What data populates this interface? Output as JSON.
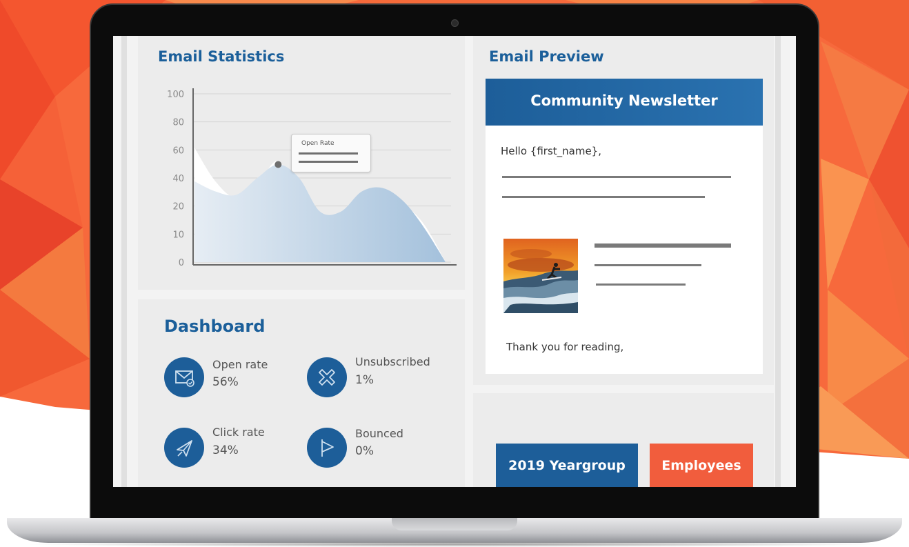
{
  "colors": {
    "brand_blue": "#1d5e99",
    "accent_orange": "#f15d3d",
    "panel_bg": "#ececec",
    "chart_fill": "#a9c4dc"
  },
  "stats": {
    "title": "Email Statistics",
    "tooltip_title": "Open Rate"
  },
  "chart_data": {
    "type": "area",
    "series": [
      {
        "x": [
          0,
          1,
          2,
          3,
          4,
          5,
          6,
          7,
          8,
          9,
          10,
          11,
          12
        ],
        "values": [
          68,
          48,
          38,
          46,
          60,
          38,
          17,
          22,
          32,
          36,
          34,
          22,
          0
        ]
      },
      {
        "x": [
          0,
          1,
          2,
          3,
          4,
          5,
          6,
          7,
          8,
          9,
          10,
          11,
          12
        ],
        "values": [
          48,
          42,
          40,
          50,
          58,
          50,
          30,
          30,
          42,
          44,
          36,
          20,
          0
        ]
      }
    ],
    "yticks": [
      "100",
      "80",
      "60",
      "40",
      "20",
      "10",
      "0"
    ],
    "ylim": [
      0,
      100
    ],
    "grid": true,
    "highlight_point": {
      "x": 4,
      "y": 58
    }
  },
  "preview": {
    "title": "Email Preview",
    "header": "Community Newsletter",
    "greeting": "Hello {first_name},",
    "signoff": "Thank you for reading,",
    "image_icon": "surfer-photo"
  },
  "dashboard": {
    "title": "Dashboard",
    "items": [
      {
        "label": "Open rate",
        "value": "56%",
        "icon": "envelope-icon"
      },
      {
        "label": "Unsubscribed",
        "value": "1%",
        "icon": "x-mark-icon"
      },
      {
        "label": "Click rate",
        "value": "34%",
        "icon": "paper-plane-icon"
      },
      {
        "label": "Bounced",
        "value": "0%",
        "icon": "flag-icon"
      }
    ]
  },
  "audience": {
    "yeargroup_label": "2019 Yeargroup",
    "employees_label": "Employees"
  }
}
